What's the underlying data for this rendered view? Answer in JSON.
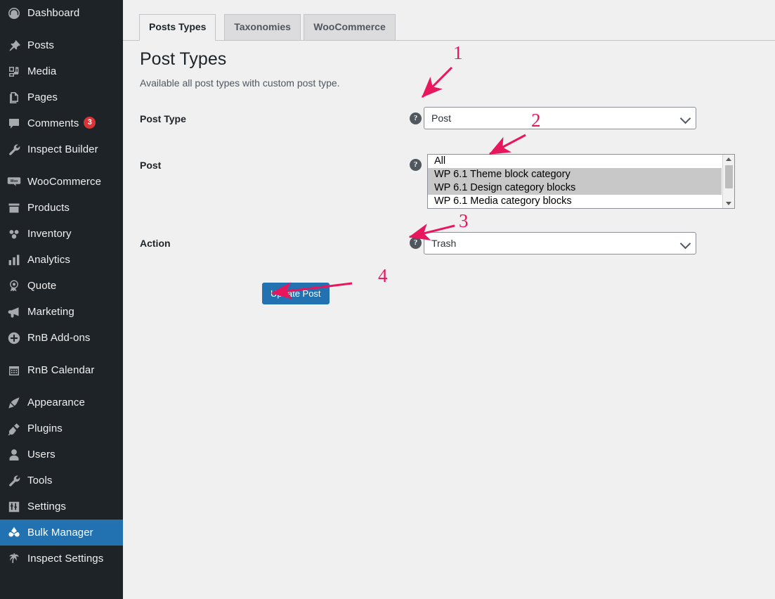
{
  "sidebar": {
    "items": [
      {
        "label": "Dashboard",
        "icon": "dashboard-icon",
        "current": false,
        "separator_after": true
      },
      {
        "label": "Posts",
        "icon": "pin-icon",
        "current": false,
        "separator_after": false
      },
      {
        "label": "Media",
        "icon": "media-icon",
        "current": false,
        "separator_after": false
      },
      {
        "label": "Pages",
        "icon": "pages-icon",
        "current": false,
        "separator_after": false
      },
      {
        "label": "Comments",
        "icon": "comment-icon",
        "current": false,
        "badge": "3",
        "separator_after": false
      },
      {
        "label": "Inspect Builder",
        "icon": "wrench-icon",
        "current": false,
        "separator_after": true
      },
      {
        "label": "WooCommerce",
        "icon": "woocommerce-icon",
        "current": false,
        "separator_after": false
      },
      {
        "label": "Products",
        "icon": "products-icon",
        "current": false,
        "separator_after": false
      },
      {
        "label": "Inventory",
        "icon": "inventory-icon",
        "current": false,
        "separator_after": false
      },
      {
        "label": "Analytics",
        "icon": "analytics-icon",
        "current": false,
        "separator_after": false
      },
      {
        "label": "Quote",
        "icon": "quote-ribbon-icon",
        "current": false,
        "separator_after": false
      },
      {
        "label": "Marketing",
        "icon": "megaphone-icon",
        "current": false,
        "separator_after": false
      },
      {
        "label": "RnB Add-ons",
        "icon": "plus-circle-icon",
        "current": false,
        "separator_after": true
      },
      {
        "label": "RnB Calendar",
        "icon": "calendar-icon",
        "current": false,
        "separator_after": true
      },
      {
        "label": "Appearance",
        "icon": "paintbrush-icon",
        "current": false,
        "separator_after": false
      },
      {
        "label": "Plugins",
        "icon": "plug-icon",
        "current": false,
        "separator_after": false
      },
      {
        "label": "Users",
        "icon": "user-icon",
        "current": false,
        "separator_after": false
      },
      {
        "label": "Tools",
        "icon": "wrench-icon",
        "current": false,
        "separator_after": false
      },
      {
        "label": "Settings",
        "icon": "sliders-icon",
        "current": false,
        "separator_after": false
      },
      {
        "label": "Bulk Manager",
        "icon": "bulk-manager-icon",
        "current": true,
        "separator_after": false
      },
      {
        "label": "Inspect Settings",
        "icon": "palm-icon",
        "current": false,
        "separator_after": false
      }
    ]
  },
  "tabs": [
    {
      "label": "Posts Types",
      "active": true
    },
    {
      "label": "Taxonomies",
      "active": false
    },
    {
      "label": "WooCommerce",
      "active": false
    }
  ],
  "page": {
    "title": "Post Types",
    "description": "Available all post types with custom post type."
  },
  "form": {
    "post_type": {
      "label": "Post Type",
      "help": "?",
      "value": "Post"
    },
    "post": {
      "label": "Post",
      "help": "?",
      "options": [
        {
          "label": "All",
          "selected": false
        },
        {
          "label": "WP 6.1 Theme block category",
          "selected": true
        },
        {
          "label": "WP 6.1 Design category blocks",
          "selected": true
        },
        {
          "label": "WP 6.1 Media category blocks",
          "selected": false
        }
      ]
    },
    "action": {
      "label": "Action",
      "help": "?",
      "value": "Trash"
    },
    "submit_label": "Update Post"
  },
  "annotations": [
    {
      "number": "1"
    },
    {
      "number": "2"
    },
    {
      "number": "3"
    },
    {
      "number": "4"
    }
  ],
  "colors": {
    "sidebar_bg": "#1d2327",
    "accent_blue": "#2271b1",
    "badge_red": "#d63638",
    "annotation_pink": "#e8175d",
    "content_bg": "#f0f0f1"
  }
}
